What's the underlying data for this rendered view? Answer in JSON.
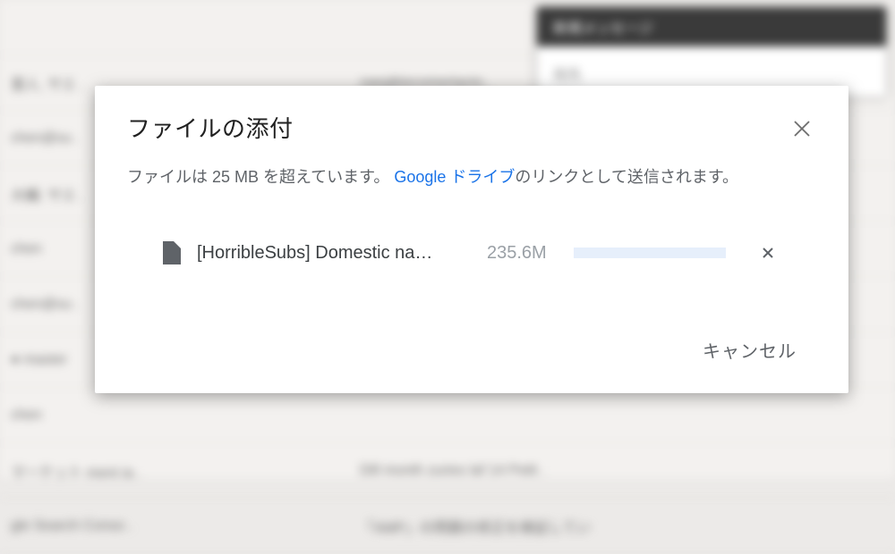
{
  "background": {
    "rows": [
      {
        "c1": "",
        "c2": ""
      },
      {
        "c1": "里人, サエ .",
        "c2": "saegikiecomertacto ."
      },
      {
        "c1": "chen@su .",
        "c2": ""
      },
      {
        "c1": "大輔. サエ .",
        "c2": ""
      },
      {
        "c1": "chen",
        "c2": ""
      },
      {
        "c1": "chen@su .",
        "c2": ""
      },
      {
        "c1": "● master",
        "c2": ""
      },
      {
        "c1": "chen",
        "c2": ""
      },
      {
        "c1": "マーケット ment ia .",
        "c2": "Dill month zuries laf 14 Petit ."
      },
      {
        "c1": "gle Search Conso .",
        "c2": "「AMP」の問題の修正を検証してい"
      }
    ],
    "compose": {
      "title": "新規メッセージ",
      "to": "宛先"
    }
  },
  "dialog": {
    "title": "ファイルの添付",
    "message_before": "ファイルは 25 MB を超えています。",
    "message_link": "Google ドライブ",
    "message_after": "のリンクとして送信されます。",
    "file": {
      "name": "[HorribleSubs] Domestic na…",
      "size": "235.6M"
    },
    "cancel_label": "キャンセル"
  }
}
